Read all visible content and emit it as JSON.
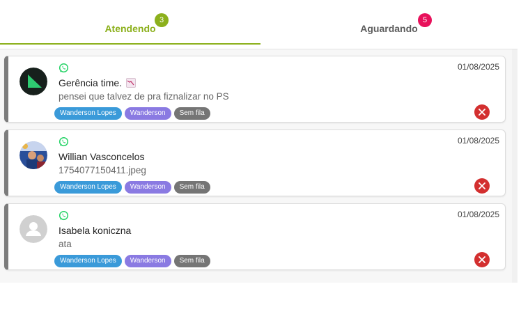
{
  "tabs": [
    {
      "label": "Atendendo",
      "badge": "3",
      "active": true
    },
    {
      "label": "Aguardando",
      "badge": "5",
      "active": false
    }
  ],
  "colors": {
    "accent": "#8cb01c",
    "badge_pink": "#e8115b",
    "close": "#d32f2f",
    "tag_blue": "#3a9ad9",
    "tag_purple": "#8a7ae2",
    "tag_gray": "#757575"
  },
  "tickets": [
    {
      "channel_icon": "whatsapp-icon",
      "date": "01/08/2025",
      "name": "Gerência time.",
      "name_icon": "chart-decreasing-emoji",
      "message": "pensei que talvez de pra fiznalizar no PS",
      "tags": [
        "Wanderson Lopes",
        "Wanderson",
        "Sem fila"
      ],
      "avatar": "logo-avatar"
    },
    {
      "channel_icon": "whatsapp-icon",
      "date": "01/08/2025",
      "name": "Willian Vasconcelos",
      "message": "1754077150411.jpeg",
      "tags": [
        "Wanderson Lopes",
        "Wanderson",
        "Sem fila"
      ],
      "avatar": "photo-avatar"
    },
    {
      "channel_icon": "whatsapp-icon",
      "date": "01/08/2025",
      "name": "Isabela koniczna",
      "message": "ata",
      "tags": [
        "Wanderson Lopes",
        "Wanderson",
        "Sem fila"
      ],
      "avatar": "default-avatar"
    }
  ]
}
